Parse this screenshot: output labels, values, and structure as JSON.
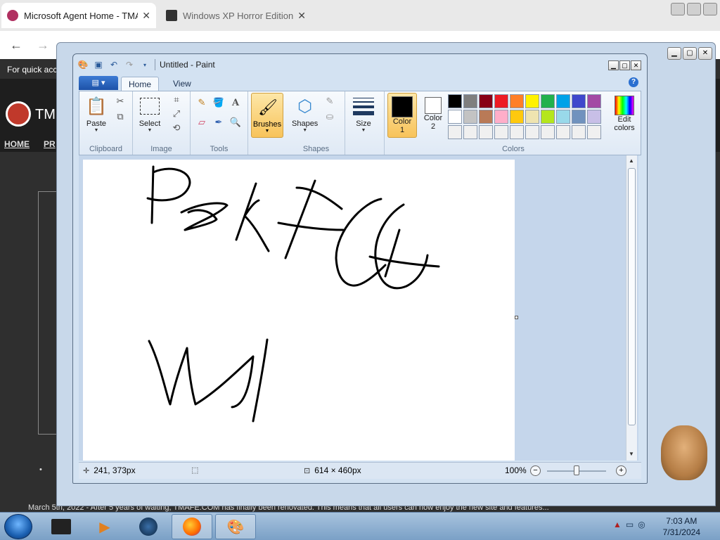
{
  "browser": {
    "tabs": [
      {
        "title": "Microsoft Agent Home - TMAFE",
        "close": "✕"
      },
      {
        "title": "Windows XP Horror Edition (D",
        "close": "✕"
      }
    ],
    "quick_access": "For quick acc",
    "site_logo_text": "TM",
    "nav_links": [
      "HOME",
      "PR"
    ],
    "news_line": "March 5th, 2022 - After 5 years of waiting, TMAFE.COM has finally been renovated. This means that all users can now enjoy the new site and features..."
  },
  "paint": {
    "title": "Untitled - Paint",
    "tabs": {
      "appmenu": "▤ ▾",
      "home": "Home",
      "view": "View"
    },
    "groups": {
      "clipboard": {
        "label": "Clipboard",
        "paste": "Paste"
      },
      "image": {
        "label": "Image",
        "select": "Select"
      },
      "tools": {
        "label": "Tools"
      },
      "brushes": {
        "label": "Brushes"
      },
      "shapes": {
        "label": "Shapes",
        "button": "Shapes"
      },
      "size": {
        "label": "Size"
      },
      "colors": {
        "label": "Colors",
        "color1": "Color\n1",
        "color1_line1": "Color",
        "color1_line2": "1",
        "color2_line1": "Color",
        "color2_line2": "2",
        "edit_colors_line1": "Edit",
        "edit_colors_line2": "colors",
        "color1_value": "#000000",
        "color2_value": "#ffffff",
        "palette_row1": [
          "#000000",
          "#7f7f7f",
          "#880015",
          "#ed1c24",
          "#ff7f27",
          "#fff200",
          "#22b14c",
          "#00a2e8",
          "#3f48cc",
          "#a349a4"
        ],
        "palette_row2": [
          "#ffffff",
          "#c3c3c3",
          "#b97a57",
          "#ffaec9",
          "#ffc90e",
          "#efe4b0",
          "#b5e61d",
          "#99d9ea",
          "#7092be",
          "#c8bfe7"
        ],
        "palette_row3": [
          "#f0f0f0",
          "#f0f0f0",
          "#f0f0f0",
          "#f0f0f0",
          "#f0f0f0",
          "#f0f0f0",
          "#f0f0f0",
          "#f0f0f0",
          "#f0f0f0",
          "#f0f0f0"
        ]
      }
    },
    "status": {
      "cursor_pos": "241, 373px",
      "selection_size": "",
      "canvas_size": "614 × 460px",
      "zoom": "100%"
    }
  },
  "taskbar": {
    "time": "7:03 AM",
    "date": "7/31/2024"
  }
}
